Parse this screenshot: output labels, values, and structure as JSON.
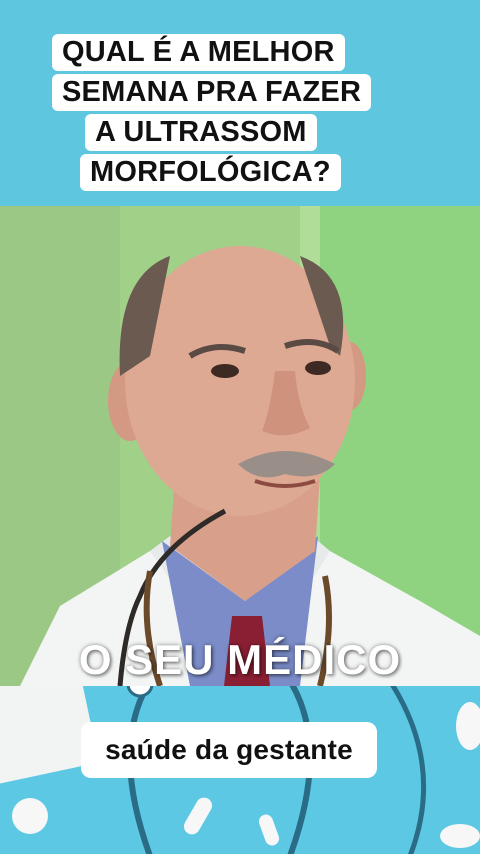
{
  "header": {
    "title_lines": [
      "QUAL É A MELHOR",
      "SEMANA PRA FAZER",
      "A ULTRASSOM",
      "MORFOLÓGICA?"
    ]
  },
  "video": {
    "overlay_text": "O SEU MÉDICO"
  },
  "footer": {
    "caption": "saúde da gestante"
  },
  "colors": {
    "background_blue": "#5ec6de",
    "title_box": "#ffffff",
    "wall_green": "#a6d58c"
  }
}
